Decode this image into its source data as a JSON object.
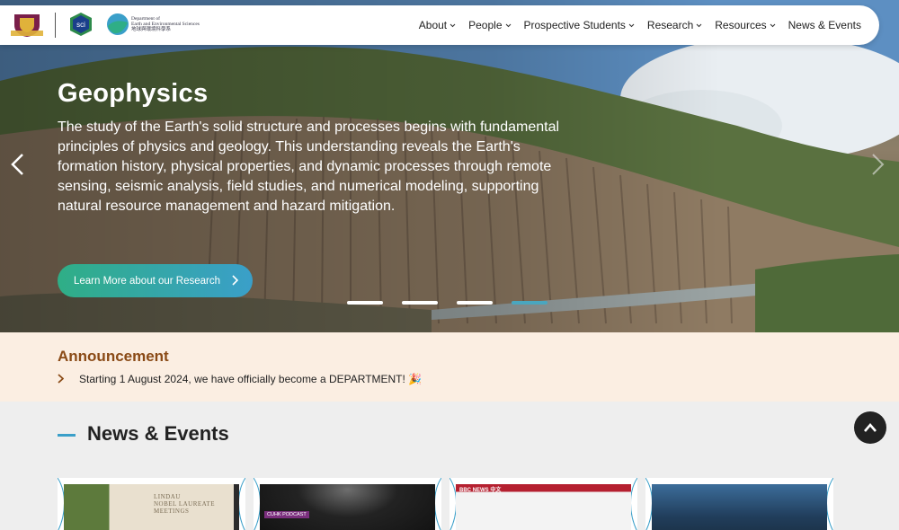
{
  "nav": {
    "items": [
      {
        "label": "About"
      },
      {
        "label": "People"
      },
      {
        "label": "Prospective Students"
      },
      {
        "label": "Research"
      },
      {
        "label": "Resources"
      },
      {
        "label": "News & Events"
      }
    ],
    "logos": {
      "crest": "cuhk-crest-icon",
      "sci": "sci",
      "ees_line1": "Department of",
      "ees_line2": "Earth and Environmental Sciences",
      "ees_line3": "地球與環境科學系"
    }
  },
  "hero": {
    "title": "Geophysics",
    "description": "The study of the Earth's solid structure and processes begins with fundamental principles of physics and geology. This understanding reveals the Earth's formation history, physical properties, and dynamic processes through remote sensing, seismic analysis, field studies, and numerical modeling, supporting natural resource management and hazard mitigation.",
    "cta_label": "Learn More about our Research",
    "slide_count": 4,
    "active_slide": 4
  },
  "announcement": {
    "title": "Announcement",
    "text": "Starting 1 August 2024, we have officially become a DEPARTMENT! 🎉"
  },
  "news": {
    "title": "News & Events",
    "cards": [
      {
        "tag": "LINDAU\nNOBEL LAUREATE\nMEETINGS"
      },
      {
        "tag": "CUHK PODCAST"
      },
      {
        "tag": "BBC NEWS 中文"
      },
      {
        "tag": ""
      }
    ]
  },
  "colors": {
    "accent_teal": "#3a9fc9",
    "accent_green": "#2fae86",
    "announce_bg": "#fbeee2",
    "announce_title": "#8a4a16"
  }
}
